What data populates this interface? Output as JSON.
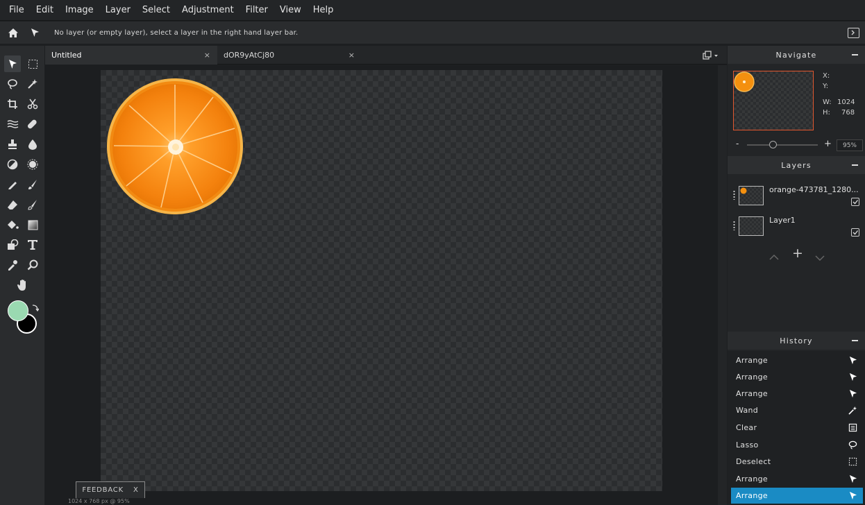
{
  "menu": [
    "File",
    "Edit",
    "Image",
    "Layer",
    "Select",
    "Adjustment",
    "Filter",
    "View",
    "Help"
  ],
  "options_bar": {
    "message": "No layer (or empty layer), select a layer in the right hand layer bar."
  },
  "tabs": [
    {
      "label": "Untitled",
      "close": "×"
    },
    {
      "label": "dOR9yAtCj80",
      "close": "×"
    }
  ],
  "colors": {
    "foreground": "#9ad9b1",
    "background": "#000000",
    "accent": "#1a8bc4",
    "nav_border": "#e3582f"
  },
  "navigate": {
    "title": "Navigate",
    "x_label": "X:",
    "y_label": "Y:",
    "w_label": "W:",
    "w_value": "1024",
    "h_label": "H:",
    "h_value": "768",
    "zoom_minus": "-",
    "zoom_plus": "+",
    "zoom_value": "95%"
  },
  "layers": {
    "title": "Layers",
    "items": [
      {
        "name": "orange-473781_1280..."
      },
      {
        "name": "Layer1"
      }
    ],
    "add": "+"
  },
  "history": {
    "title": "History",
    "items": [
      {
        "label": "Arrange",
        "icon": "arrow-icon"
      },
      {
        "label": "Arrange",
        "icon": "arrow-icon"
      },
      {
        "label": "Arrange",
        "icon": "arrow-icon"
      },
      {
        "label": "Wand",
        "icon": "magic-wand-icon"
      },
      {
        "label": "Clear",
        "icon": "clear-icon"
      },
      {
        "label": "Lasso",
        "icon": "lasso-icon"
      },
      {
        "label": "Deselect",
        "icon": "marquee-icon"
      },
      {
        "label": "Arrange",
        "icon": "arrow-icon"
      },
      {
        "label": "Arrange",
        "icon": "arrow-icon"
      }
    ],
    "selected_index": 8
  },
  "feedback": {
    "label": "FEEDBACK",
    "close": "X"
  },
  "status": "1024 x 768 px @ 95%"
}
